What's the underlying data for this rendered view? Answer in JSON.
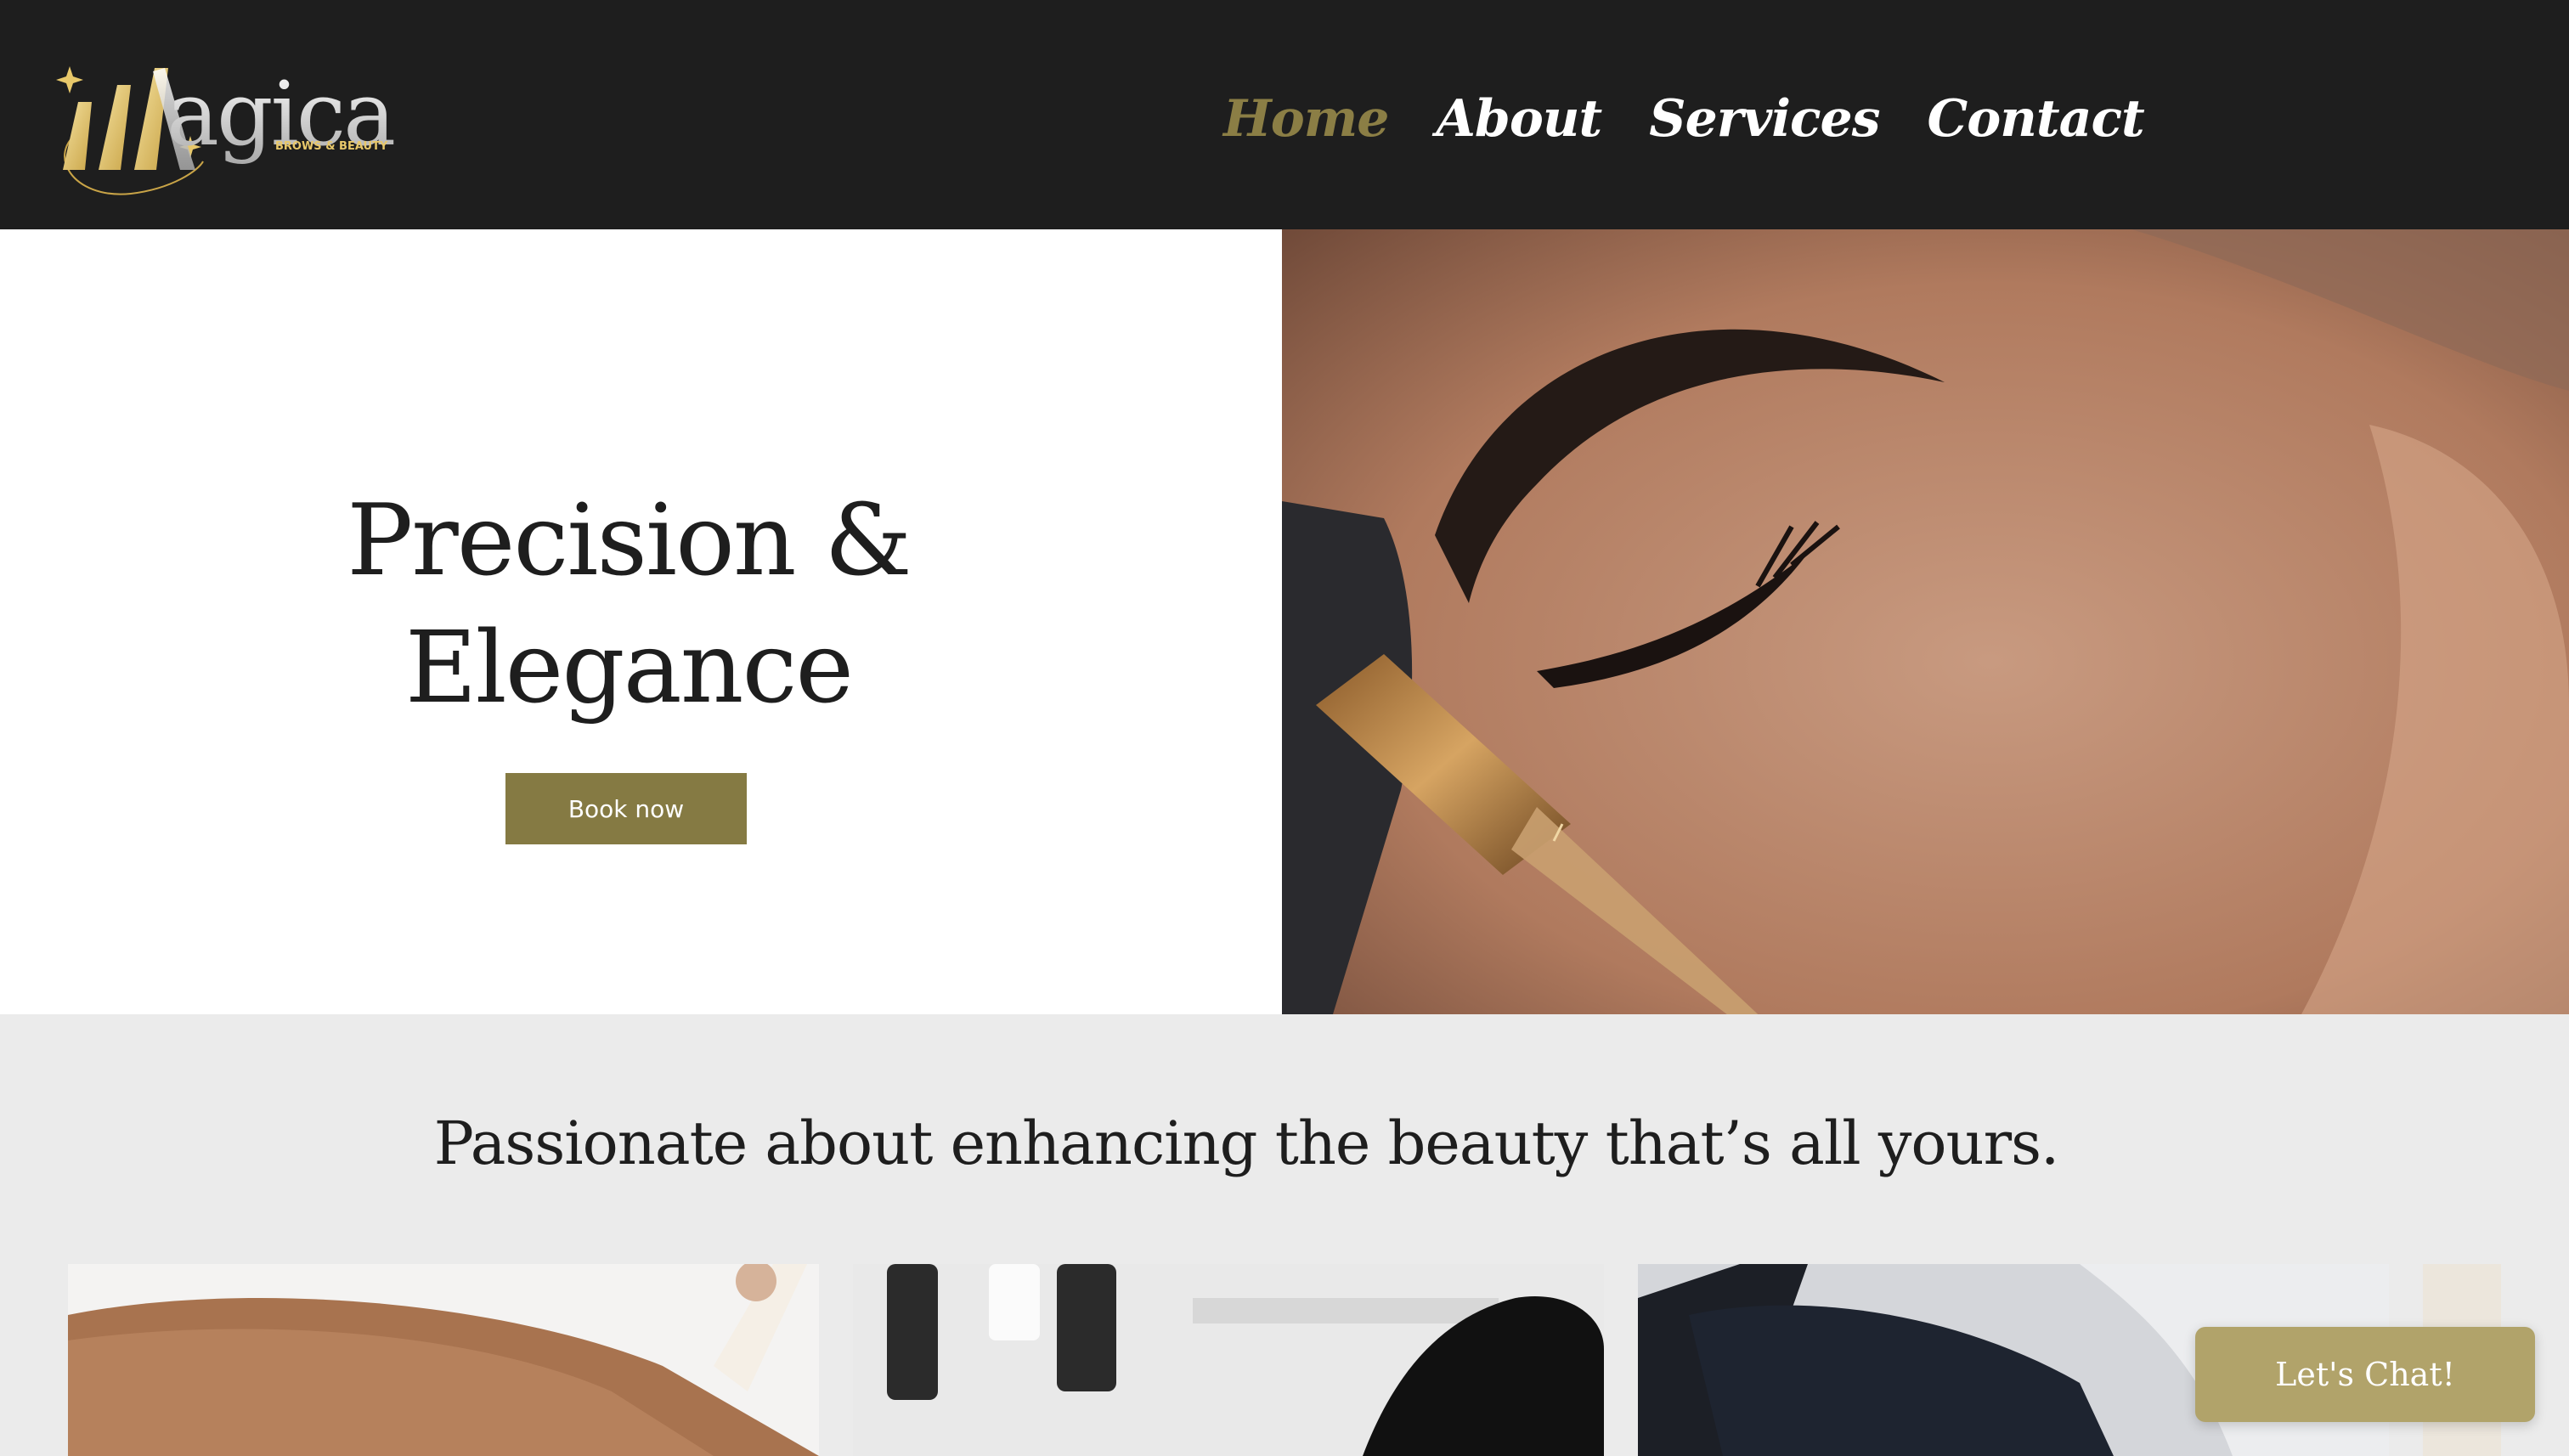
{
  "brand": {
    "logo_text": "agica",
    "logo_subtitle": "BROWS & BEAUTY",
    "logo_colors": {
      "gold": "#e8c86a",
      "silver": "#d9d9d9"
    }
  },
  "nav": {
    "items": [
      {
        "label": "Home",
        "active": true
      },
      {
        "label": "About",
        "active": false
      },
      {
        "label": "Services",
        "active": false
      },
      {
        "label": "Contact",
        "active": false
      }
    ]
  },
  "hero": {
    "title_line1": "Precision &",
    "title_line2": "Elegance",
    "cta_label": "Book now",
    "image": "brow-microblading-photo"
  },
  "intro": {
    "tagline": "Passionate about enhancing the beauty that’s all yours."
  },
  "gallery": {
    "images": [
      "lip-treatment-photo",
      "brow-tools-photo",
      "tattoo-pen-photo",
      "partial-photo"
    ]
  },
  "chat": {
    "label": "Let's Chat!"
  },
  "colors": {
    "header_bg": "#1e1e1e",
    "accent": "#857a43",
    "nav_active": "#8b7e45",
    "chat_bg": "#b1a36a",
    "section_bg": "#ebebeb"
  }
}
